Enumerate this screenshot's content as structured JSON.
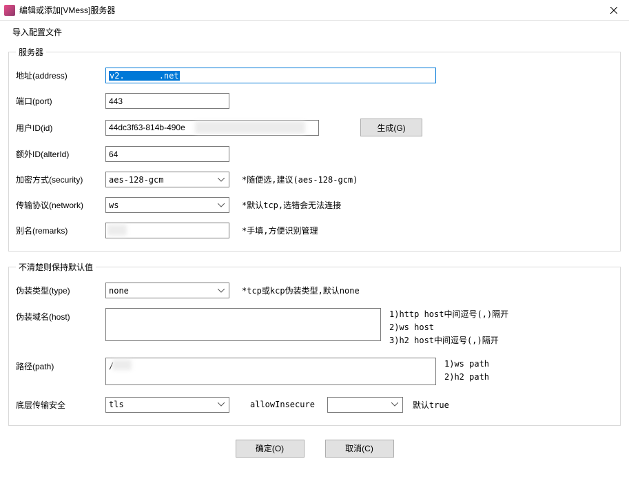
{
  "window": {
    "title": "编辑或添加[VMess]服务器"
  },
  "menu": {
    "import": "导入配置文件"
  },
  "group1": {
    "legend": "服务器",
    "address_label": "地址(address)",
    "address_prefix": "v2.",
    "address_suffix": ".net",
    "port_label": "端口(port)",
    "port_value": "443",
    "id_label": "用户ID(id)",
    "id_value": "44dc3f63-814b-490e",
    "generate_btn": "生成(G)",
    "alterid_label": "额外ID(alterId)",
    "alterid_value": "64",
    "security_label": "加密方式(security)",
    "security_value": "aes-128-gcm",
    "security_hint": "*随便选,建议(aes-128-gcm)",
    "network_label": "传输协议(network)",
    "network_value": "ws",
    "network_hint": "*默认tcp,选错会无法连接",
    "remarks_label": "别名(remarks)",
    "remarks_value": "",
    "remarks_hint": "*手填,方便识别管理"
  },
  "group2": {
    "legend": "不清楚则保持默认值",
    "type_label": "伪装类型(type)",
    "type_value": "none",
    "type_hint": "*tcp或kcp伪装类型,默认none",
    "host_label": "伪装域名(host)",
    "host_value": "",
    "host_hint1": "1)http host中间逗号(,)隔开",
    "host_hint2": "2)ws host",
    "host_hint3": "3)h2 host中间逗号(,)隔开",
    "path_label": "路径(path)",
    "path_value": "/",
    "path_hint1": "1)ws path",
    "path_hint2": "2)h2 path",
    "tls_label": "底层传输安全",
    "tls_value": "tls",
    "allow_insecure_label": "allowInsecure",
    "allow_insecure_value": "",
    "allow_insecure_hint": "默认true"
  },
  "buttons": {
    "ok": "确定(O)",
    "cancel": "取消(C)"
  }
}
